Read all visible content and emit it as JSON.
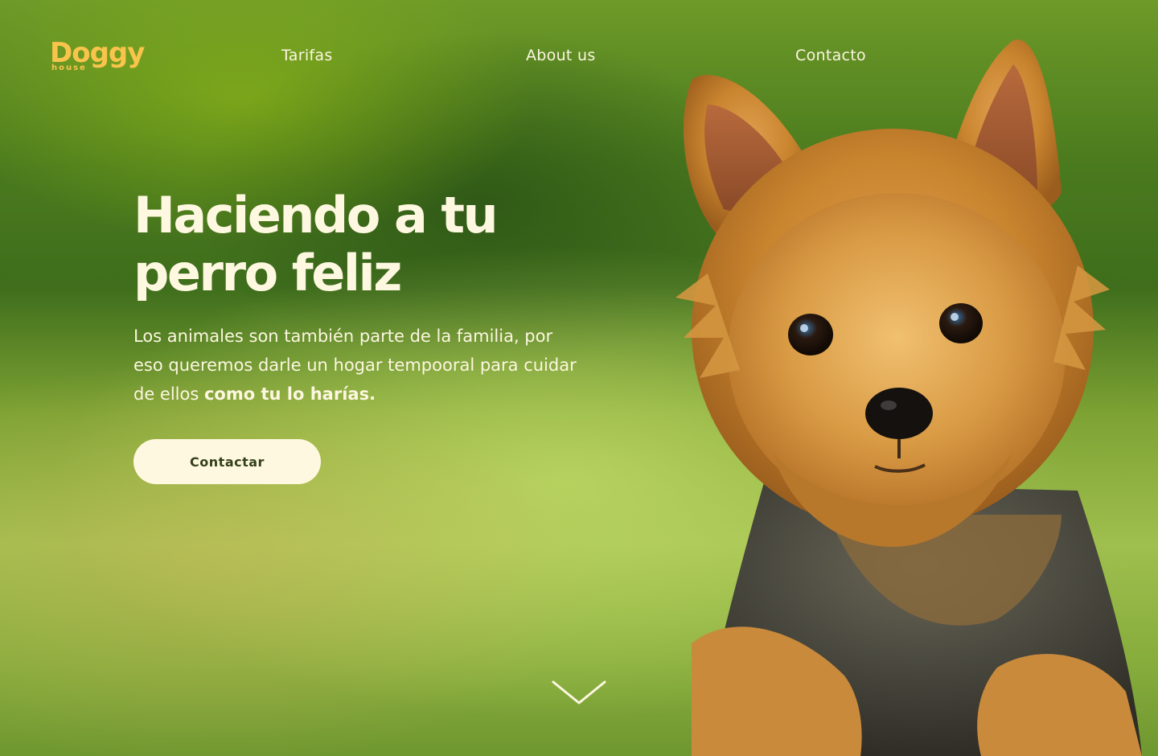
{
  "brand": {
    "logo_main": "Doggy",
    "logo_sub": "house",
    "accent_color": "#f9c44c"
  },
  "nav": {
    "items": [
      {
        "label": "Tarifas"
      },
      {
        "label": "About us"
      },
      {
        "label": "Contacto"
      }
    ]
  },
  "hero": {
    "headline_line1": "Haciendo a tu",
    "headline_line2": "perro feliz",
    "subtitle_part1": "Los animales son también parte de la familia, por eso queremos darle un hogar tempooral para cuidar de ellos ",
    "subtitle_bold": "como tu lo harías.",
    "cta_label": "Contactar",
    "cta_bg": "#fff8e1",
    "scroll_icon": "chevron-down-icon",
    "image": "yorkshire-terrier-photo"
  }
}
